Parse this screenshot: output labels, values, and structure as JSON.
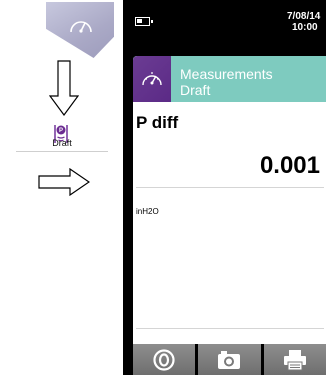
{
  "help": {
    "draft_label": "Draft"
  },
  "device": {
    "status": {
      "date": "7/08/14",
      "time": "10:00"
    },
    "header": {
      "title_line1": "Measurements",
      "title_line2": "Draft"
    },
    "measurement": {
      "name": "P diff",
      "value": "0.001",
      "unit": "inH2O"
    },
    "toolbar": {
      "buttons": [
        "power-icon",
        "camera-icon",
        "printer-icon"
      ]
    }
  },
  "colors": {
    "header_teal": "#7ecbbf",
    "icon_purple": "#5b2a86",
    "tile_lavender": "#aaa9c6"
  }
}
